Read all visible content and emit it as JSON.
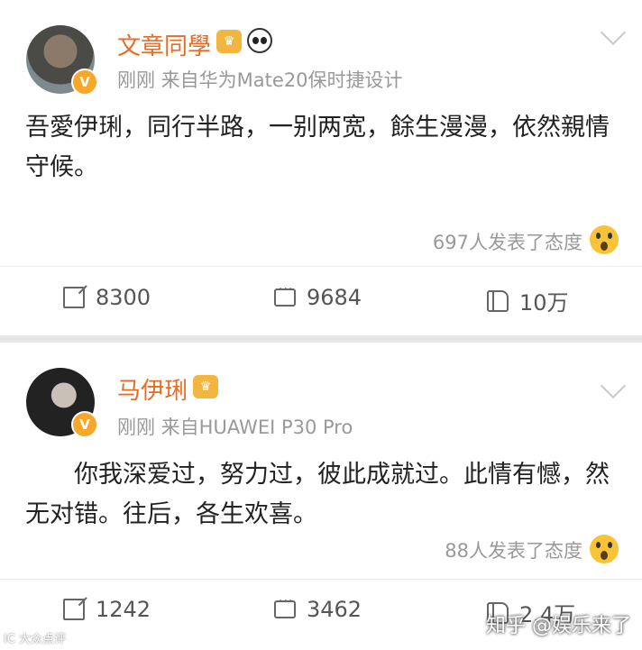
{
  "posts": [
    {
      "author": "文章同學",
      "meta": "刚刚  来自华为Mate20保时捷设计",
      "text": "吾愛伊琍，同行半路，一别两宽，餘生漫漫，依然親情守候。",
      "attitude": "697人发表了态度",
      "shares": "8300",
      "comments": "9684",
      "likes": "10万",
      "badge": "V"
    },
    {
      "author": "马伊琍",
      "meta": "刚刚  来自HUAWEI P30 Pro",
      "text": "你我深爱过，努力过，彼此成就过。此情有憾，然无对错。往后，各生欢喜。",
      "attitude": "88人发表了态度",
      "shares": "1242",
      "comments": "3462",
      "likes": "2.4万",
      "badge": "V"
    }
  ],
  "watermarks": {
    "left": "IC 大众点评",
    "right": "知乎 @娱乐来了"
  },
  "icons": [
    "avatar",
    "verified-badge-icon",
    "crown-icon",
    "panda-icon",
    "chevron-down-icon",
    "wow-emoji-icon",
    "share-icon",
    "comment-icon",
    "like-icon"
  ]
}
